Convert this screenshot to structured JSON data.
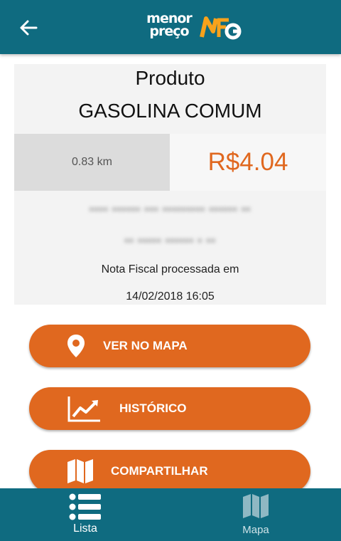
{
  "appbar": {
    "logo_text": "menor preço",
    "logo_icons": [
      "back-arrow-icon",
      "nfg-logo-icon"
    ]
  },
  "product": {
    "label": "Produto",
    "name": "GASOLINA COMUM",
    "distance": "0.83 km",
    "price": "R$4.04",
    "note": "Nota Fiscal processada em",
    "date": "14/02/2018 16:05"
  },
  "actions": {
    "map_label": "VER NO MAPA",
    "history_label": "HISTÓRICO",
    "share_label": "COMPARTILHAR"
  },
  "bottom_nav": {
    "list_label": "Lista",
    "map_label": "Mapa"
  },
  "colors": {
    "primary": "#0f6b80",
    "accent": "#e0681f",
    "card": "#f3f3f3"
  }
}
